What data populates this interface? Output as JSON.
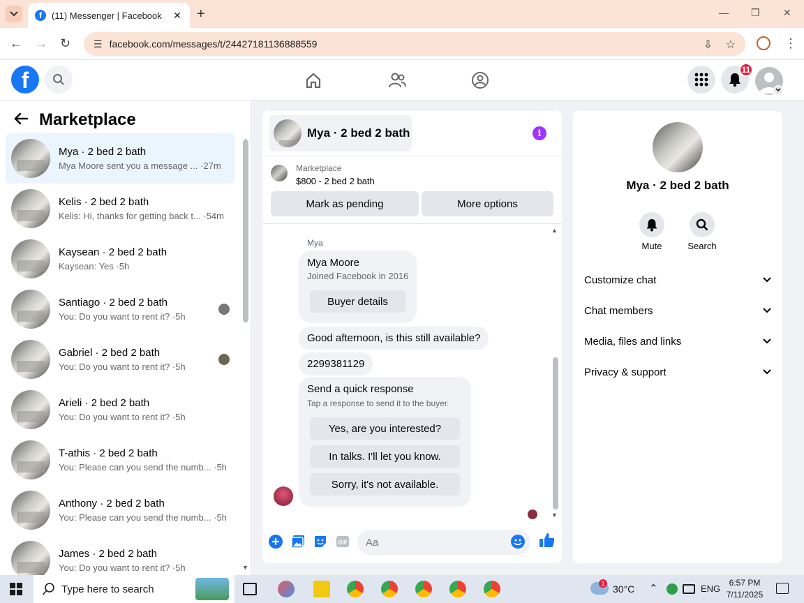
{
  "browser": {
    "tab_title": "(11) Messenger | Facebook",
    "url": "facebook.com/messages/t/24427181136888559"
  },
  "header": {
    "notification_count": "11"
  },
  "sidebar": {
    "title": "Marketplace",
    "conversations": [
      {
        "name": "Mya · 2 bed 2 bath",
        "preview": "Mya Moore sent you a message ... ·27m"
      },
      {
        "name": "Kelis · 2 bed 2 bath",
        "preview": "Kelis: Hi, thanks for getting back t... ·54m"
      },
      {
        "name": "Kaysean · 2 bed 2 bath",
        "preview": "Kaysean: Yes ·5h"
      },
      {
        "name": "Santiago · 2 bed 2 bath",
        "preview": "You: Do you want to rent it? ·5h"
      },
      {
        "name": "Gabriel · 2 bed 2 bath",
        "preview": "You: Do you want to rent it? ·5h"
      },
      {
        "name": "Arieli · 2 bed 2 bath",
        "preview": "You: Do you want to rent it? ·5h"
      },
      {
        "name": "T-athis · 2 bed 2 bath",
        "preview": "You: Please can you send the numb... ·5h"
      },
      {
        "name": "Anthony · 2 bed 2 bath",
        "preview": "You: Please can you send the numb... ·5h"
      },
      {
        "name": "James · 2 bed 2 bath",
        "preview": "You: Do you want to rent it? ·5h"
      }
    ]
  },
  "chat": {
    "title": "Mya · 2 bed 2 bath",
    "marketplace_label": "Marketplace",
    "listing": "$800 - 2 bed 2 bath",
    "mark_pending": "Mark as pending",
    "more_options": "More options",
    "sender": "Mya",
    "card_name": "Mya Moore",
    "card_joined": "Joined Facebook in 2016",
    "buyer_details": "Buyer details",
    "msg1": "Good afternoon, is this still available?",
    "msg2": "2299381129",
    "quick_title": "Send a quick response",
    "quick_sub": "Tap a response to send it to the buyer.",
    "quick_options": [
      "Yes, are you interested?",
      "In talks. I'll let you know.",
      "Sorry, it's not available."
    ],
    "composer_placeholder": "Aa"
  },
  "info": {
    "name": "Mya · 2 bed 2 bath",
    "mute": "Mute",
    "search": "Search",
    "sections": [
      "Customize chat",
      "Chat members",
      "Media, files and links",
      "Privacy & support"
    ]
  },
  "taskbar": {
    "search_placeholder": "Type here to search",
    "weather": "30°C",
    "weather_badge": "1",
    "lang": "ENG",
    "time": "6:57 PM",
    "date": "7/11/2025"
  },
  "colors": {
    "facebook_blue": "#1877f2",
    "active_conv_bg": "#ebf5ff",
    "info_purple": "#a033ff",
    "notification_red": "#e41e3f"
  }
}
